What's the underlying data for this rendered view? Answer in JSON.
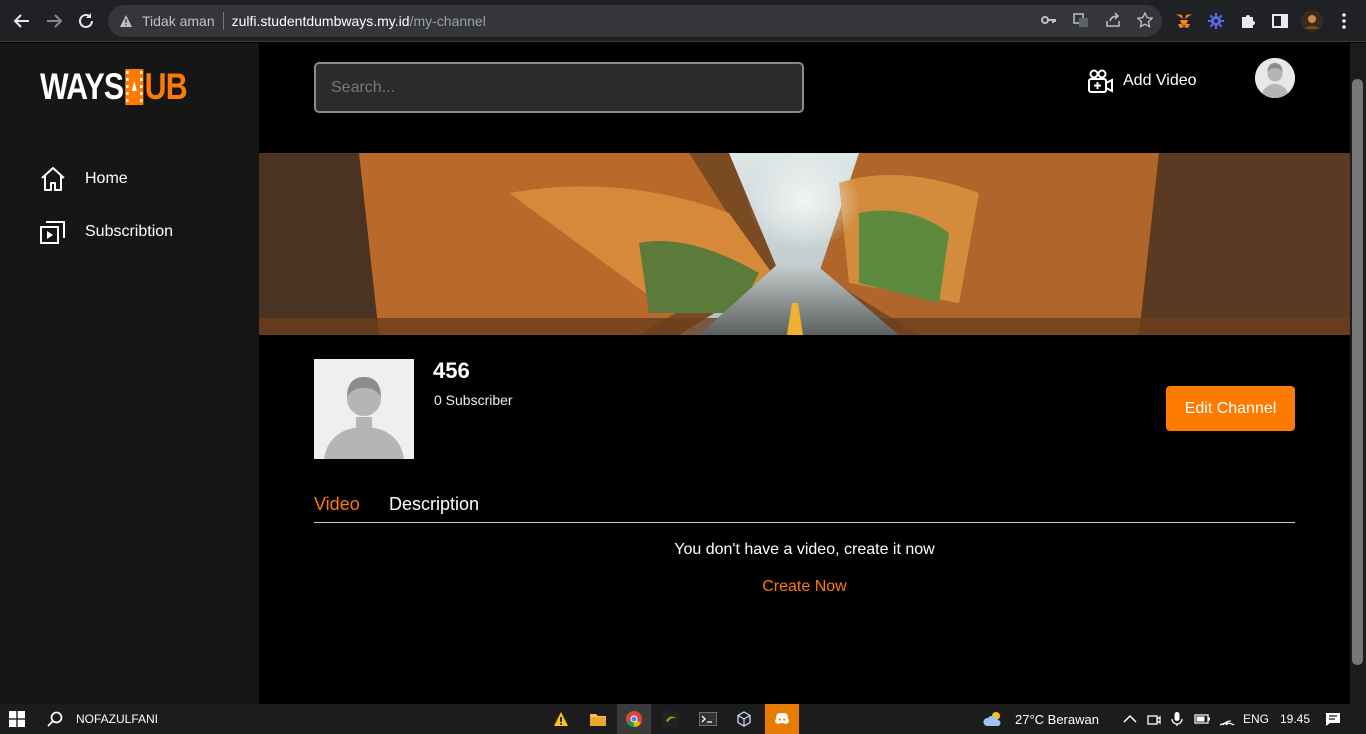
{
  "browser": {
    "security_label": "Tidak aman",
    "url_host": "zulfi.studentdumbways.my.id",
    "url_path": "/my-channel"
  },
  "sidebar": {
    "logo_left": "WAYS",
    "logo_right": "UB",
    "items": [
      {
        "label": "Home",
        "icon": "home-icon"
      },
      {
        "label": "Subscribtion",
        "icon": "subscription-icon"
      }
    ]
  },
  "header": {
    "search_placeholder": "Search...",
    "add_video_label": "Add Video"
  },
  "channel": {
    "name": "456",
    "subscribers": "0 Subscriber",
    "edit_label": "Edit Channel"
  },
  "tabs": [
    {
      "label": "Video",
      "active": true
    },
    {
      "label": "Description",
      "active": false
    }
  ],
  "empty_state": {
    "message": "You don't have a video, create it now",
    "action": "Create Now"
  },
  "taskbar": {
    "user": "NOFAZULFANI",
    "weather": "27°C  Berawan",
    "language": "ENG",
    "time": "19.45"
  },
  "colors": {
    "accent": "#ff7a00",
    "sidebar_bg": "#161616",
    "main_bg": "#000000"
  }
}
